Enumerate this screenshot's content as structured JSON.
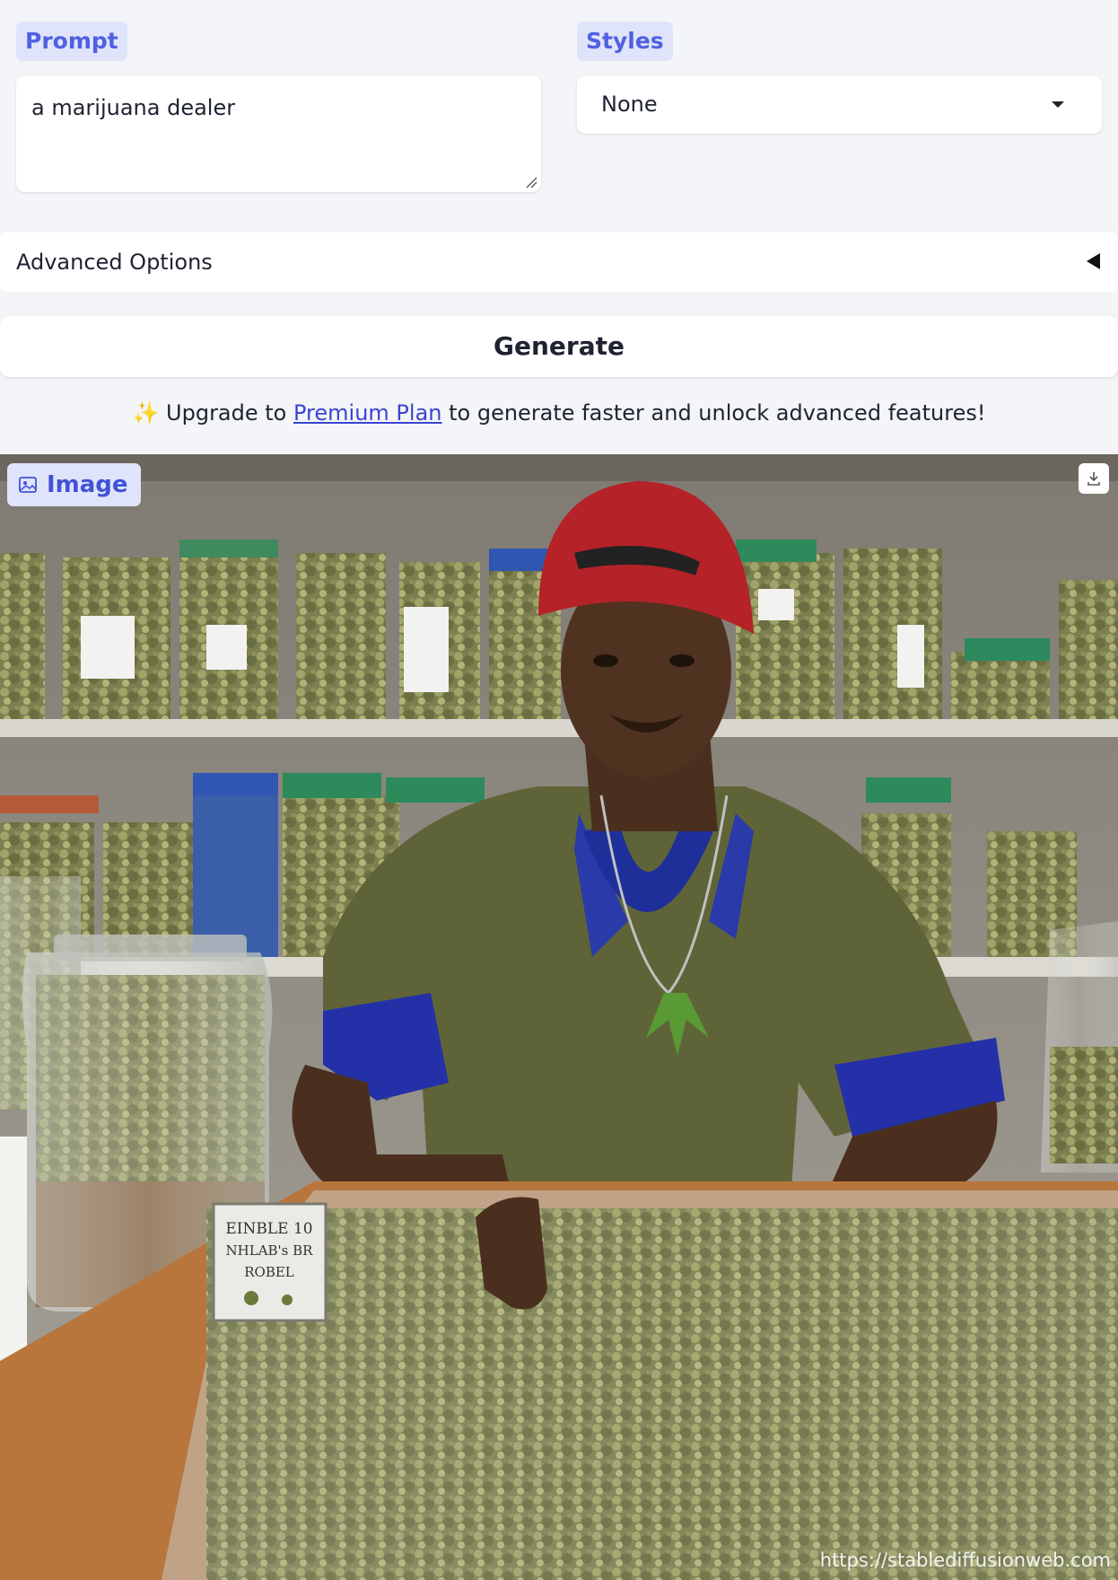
{
  "prompt": {
    "label": "Prompt",
    "value": "a marijuana dealer"
  },
  "styles": {
    "label": "Styles",
    "selected": "None"
  },
  "advanced": {
    "label": "Advanced Options"
  },
  "generate": {
    "label": "Generate"
  },
  "upgrade": {
    "icon": "sparkles-icon",
    "prefix": "✨ Upgrade to ",
    "link": "Premium Plan",
    "suffix": " to generate faster and unlock advanced features!"
  },
  "output": {
    "label": "Image",
    "watermark": "https://stablediffusionweb.com",
    "sign_text": [
      "EINBLE 10",
      "NHLAB's BR",
      "ROBEL"
    ]
  }
}
